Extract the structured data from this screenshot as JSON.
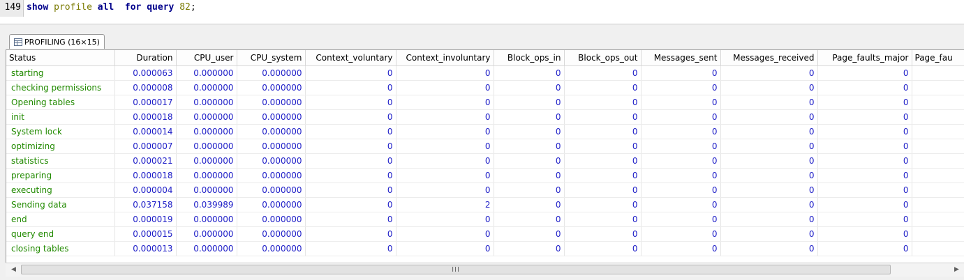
{
  "editor": {
    "line_number": "149",
    "tokens": {
      "kw1": "show",
      "fn1": "profile",
      "kw2": "all",
      "kw3": "for",
      "kw4": "query",
      "num": "82",
      "end": ";"
    }
  },
  "result_tab": {
    "icon": "grid-icon",
    "label": "PROFILING (16×15)"
  },
  "columns": [
    "Status",
    "Duration",
    "CPU_user",
    "CPU_system",
    "Context_voluntary",
    "Context_involuntary",
    "Block_ops_in",
    "Block_ops_out",
    "Messages_sent",
    "Messages_received",
    "Page_faults_major",
    "Page_fau"
  ],
  "rows": [
    [
      "starting",
      "0.000063",
      "0.000000",
      "0.000000",
      "0",
      "0",
      "0",
      "0",
      "0",
      "0",
      "0"
    ],
    [
      "checking permissions",
      "0.000008",
      "0.000000",
      "0.000000",
      "0",
      "0",
      "0",
      "0",
      "0",
      "0",
      "0"
    ],
    [
      "Opening tables",
      "0.000017",
      "0.000000",
      "0.000000",
      "0",
      "0",
      "0",
      "0",
      "0",
      "0",
      "0"
    ],
    [
      "init",
      "0.000018",
      "0.000000",
      "0.000000",
      "0",
      "0",
      "0",
      "0",
      "0",
      "0",
      "0"
    ],
    [
      "System lock",
      "0.000014",
      "0.000000",
      "0.000000",
      "0",
      "0",
      "0",
      "0",
      "0",
      "0",
      "0"
    ],
    [
      "optimizing",
      "0.000007",
      "0.000000",
      "0.000000",
      "0",
      "0",
      "0",
      "0",
      "0",
      "0",
      "0"
    ],
    [
      "statistics",
      "0.000021",
      "0.000000",
      "0.000000",
      "0",
      "0",
      "0",
      "0",
      "0",
      "0",
      "0"
    ],
    [
      "preparing",
      "0.000018",
      "0.000000",
      "0.000000",
      "0",
      "0",
      "0",
      "0",
      "0",
      "0",
      "0"
    ],
    [
      "executing",
      "0.000004",
      "0.000000",
      "0.000000",
      "0",
      "0",
      "0",
      "0",
      "0",
      "0",
      "0"
    ],
    [
      "Sending data",
      "0.037158",
      "0.039989",
      "0.000000",
      "0",
      "2",
      "0",
      "0",
      "0",
      "0",
      "0"
    ],
    [
      "end",
      "0.000019",
      "0.000000",
      "0.000000",
      "0",
      "0",
      "0",
      "0",
      "0",
      "0",
      "0"
    ],
    [
      "query end",
      "0.000015",
      "0.000000",
      "0.000000",
      "0",
      "0",
      "0",
      "0",
      "0",
      "0",
      "0"
    ],
    [
      "closing tables",
      "0.000013",
      "0.000000",
      "0.000000",
      "0",
      "0",
      "0",
      "0",
      "0",
      "0",
      "0"
    ]
  ],
  "scrollbar": {
    "thumb_grip": "III",
    "left_arrow": "◀",
    "right_arrow": "▶"
  }
}
